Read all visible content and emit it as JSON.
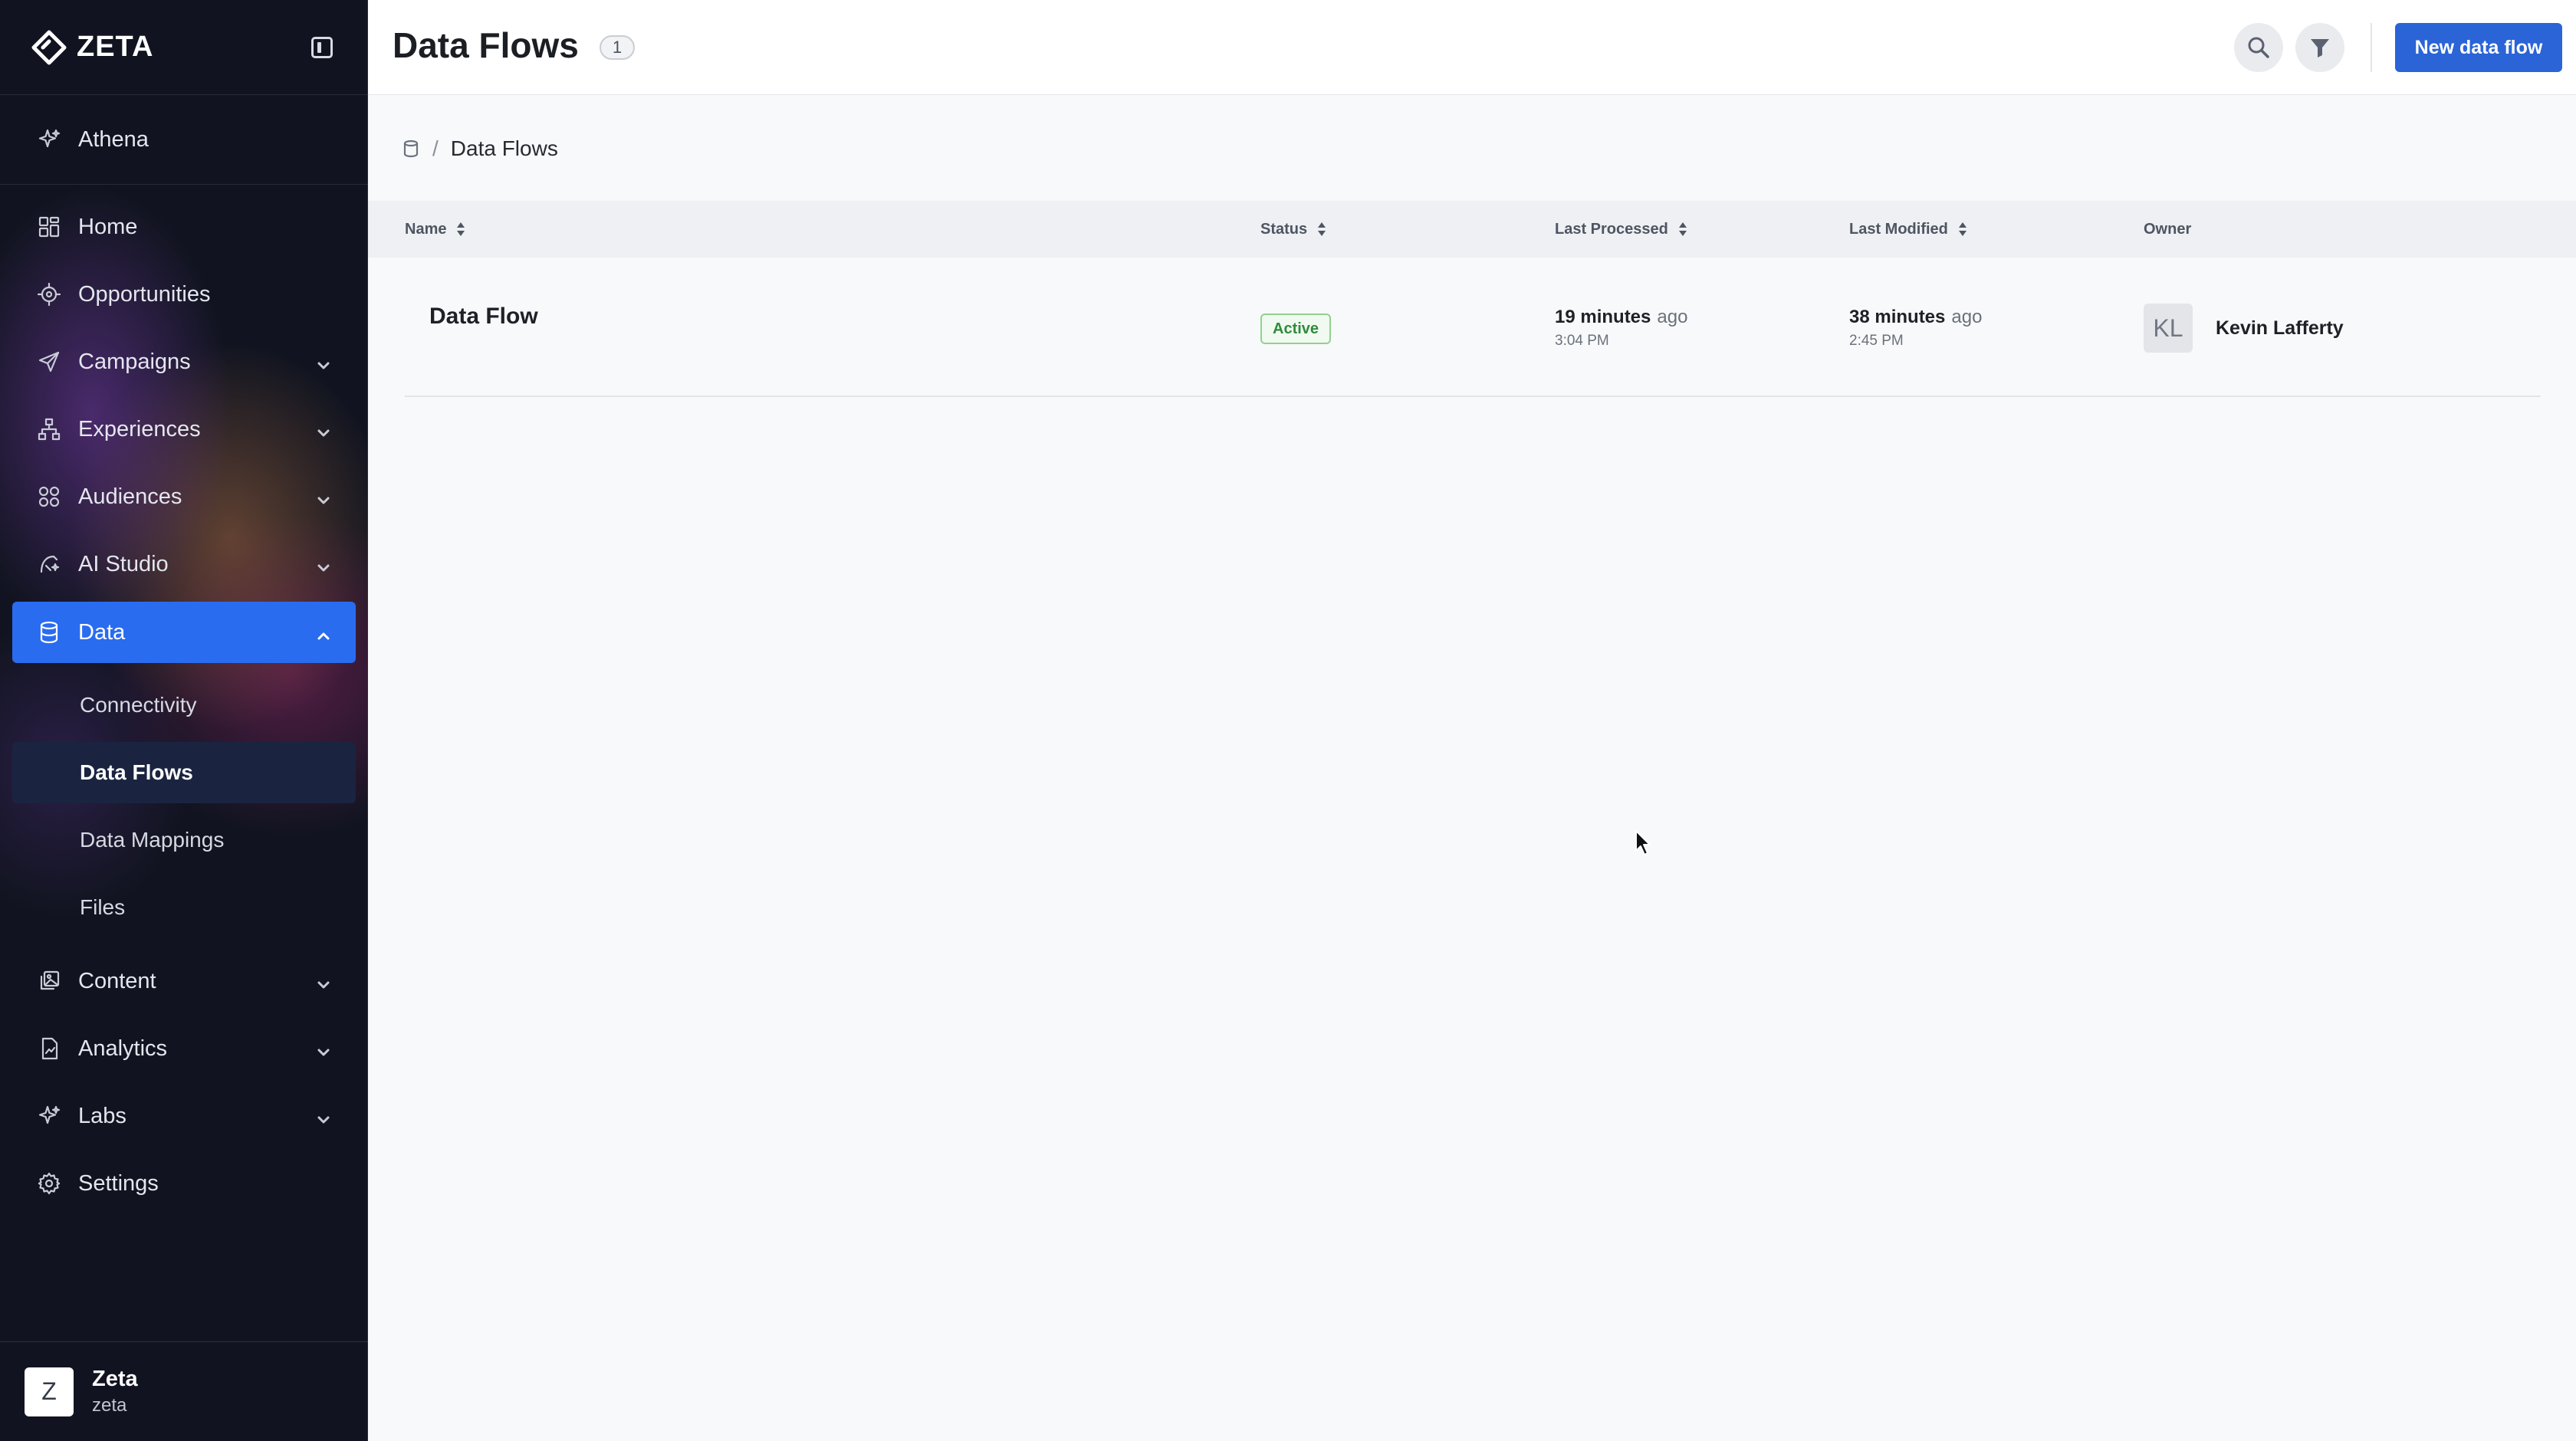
{
  "brand": {
    "name": "ZETA"
  },
  "sidebar": {
    "items": [
      {
        "label": "Athena",
        "icon": "sparkle-icon"
      },
      {
        "label": "Home",
        "icon": "grid-icon"
      },
      {
        "label": "Opportunities",
        "icon": "target-icon"
      },
      {
        "label": "Campaigns",
        "icon": "send-icon",
        "expandable": true
      },
      {
        "label": "Experiences",
        "icon": "hierarchy-icon",
        "expandable": true
      },
      {
        "label": "Audiences",
        "icon": "audiences-icon",
        "expandable": true
      },
      {
        "label": "AI Studio",
        "icon": "ai-studio-icon",
        "expandable": true
      },
      {
        "label": "Data",
        "icon": "database-icon",
        "expandable": true,
        "expanded": true,
        "active": true
      },
      {
        "label": "Content",
        "icon": "content-icon",
        "expandable": true
      },
      {
        "label": "Analytics",
        "icon": "analytics-icon",
        "expandable": true
      },
      {
        "label": "Labs",
        "icon": "sparkle-icon",
        "expandable": true
      },
      {
        "label": "Settings",
        "icon": "gear-icon"
      }
    ],
    "data_subitems": [
      {
        "label": "Connectivity"
      },
      {
        "label": "Data Flows",
        "active": true
      },
      {
        "label": "Data Mappings"
      },
      {
        "label": "Files"
      }
    ],
    "user": {
      "initial": "Z",
      "name": "Zeta",
      "org": "zeta"
    }
  },
  "header": {
    "title": "Data Flows",
    "count": "1",
    "new_button_label": "New data flow"
  },
  "breadcrumb": {
    "current": "Data Flows"
  },
  "table": {
    "columns": [
      {
        "label": "Name",
        "sortable": true
      },
      {
        "label": "Status",
        "sortable": true
      },
      {
        "label": "Last Processed",
        "sortable": true
      },
      {
        "label": "Last Modified",
        "sortable": true
      },
      {
        "label": "Owner",
        "sortable": false
      }
    ],
    "rows": [
      {
        "name": "Data Flow",
        "status": "Active",
        "last_processed": {
          "amount": "19 minutes",
          "suffix": "ago",
          "time": "3:04 PM"
        },
        "last_modified": {
          "amount": "38 minutes",
          "suffix": "ago",
          "time": "2:45 PM"
        },
        "owner": {
          "initials": "KL",
          "name": "Kevin Lafferty"
        }
      }
    ]
  },
  "colors": {
    "accent": "#2a6cf0",
    "primary_button": "#2a64d6",
    "sidebar_bg": "#111420",
    "status_active": "#2e8b3d"
  }
}
